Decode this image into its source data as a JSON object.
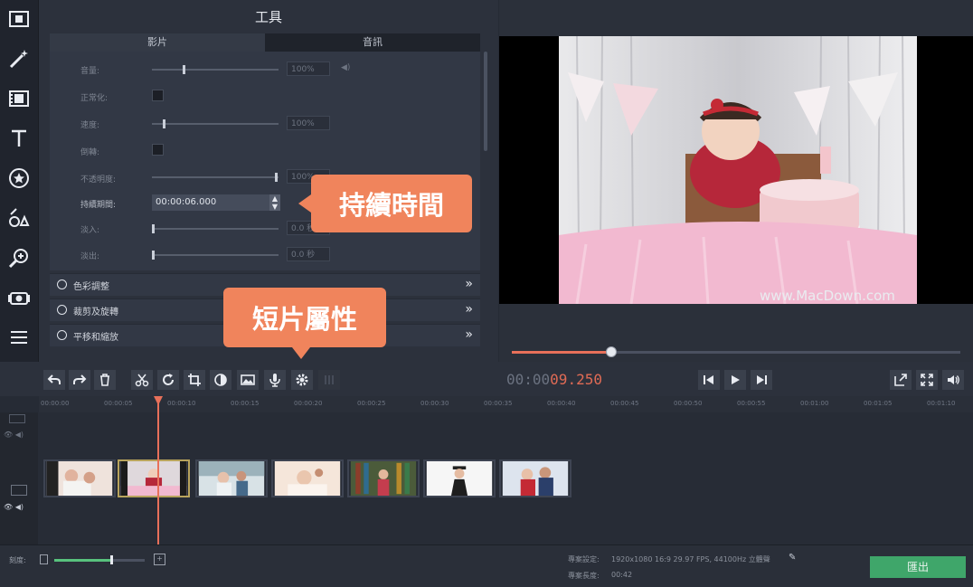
{
  "tools_panel": {
    "title": "工具",
    "tabs": [
      "影片",
      "音訊"
    ],
    "properties": [
      {
        "label": "音量:",
        "value": "100%"
      },
      {
        "label": "正常化:"
      },
      {
        "label": "速度:",
        "value": "100%"
      },
      {
        "label": "倒轉:"
      },
      {
        "label": "不透明度:",
        "value": "100%"
      },
      {
        "label": "持續期間:",
        "value": "00:00:06.000"
      },
      {
        "label": "淡入:",
        "value": "0.0 秒"
      },
      {
        "label": "淡出:",
        "value": "0.0 秒"
      }
    ],
    "sections": [
      "色彩調整",
      "裁剪及旋轉",
      "平移和縮放"
    ]
  },
  "callouts": {
    "duration": "持續時間",
    "clip_properties": "短片屬性"
  },
  "preview": {
    "watermark": "www.MacDown.com",
    "timecode_elapsed": "00:00",
    "timecode_fraction": "09.250"
  },
  "timeline": {
    "ruler": [
      "00:00:00",
      "00:00:05",
      "00:00:10",
      "00:00:15",
      "00:00:20",
      "00:00:25",
      "00:00:30",
      "00:00:35",
      "00:00:40",
      "00:00:45",
      "00:00:50",
      "00:00:55",
      "00:01:00",
      "00:01:05",
      "00:01:10"
    ],
    "clips": [
      "clip-1",
      "clip-2",
      "clip-3",
      "clip-4",
      "clip-5",
      "clip-6",
      "clip-7"
    ],
    "playhead_seconds": 9.25
  },
  "bottom_bar": {
    "scale_label": "刻度:",
    "project_settings_label": "專案設定:",
    "project_settings_value": "1920x1080 16:9 29.97 FPS, 44100Hz 立體聲",
    "project_length_label": "專案長度:",
    "project_length_value": "00:42",
    "export_label": "匯出"
  },
  "colors": {
    "accent": "#e8705a",
    "callout": "#f0845c",
    "export": "#3fa66a"
  },
  "icons": {
    "rail": [
      "import-icon",
      "magic-wand-icon",
      "filters-icon",
      "text-icon",
      "stickers-icon",
      "transitions-icon",
      "zoom-icon",
      "record-icon",
      "more-icon"
    ],
    "toolbar": [
      "undo-icon",
      "redo-icon",
      "delete-icon",
      "cut-icon",
      "rotate-icon",
      "crop-icon",
      "color-adjust-icon",
      "image-icon",
      "mic-icon",
      "gear-icon"
    ]
  }
}
